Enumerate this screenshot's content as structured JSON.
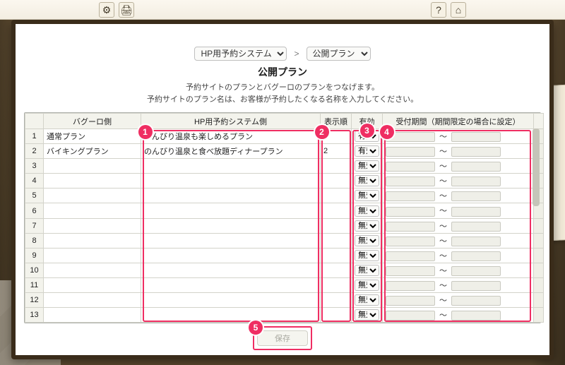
{
  "toolbar": {
    "gear_icon": "⚙",
    "print_icon": "🖨",
    "help_icon": "?",
    "home_icon": "⌂"
  },
  "breadcrumb": {
    "system_select_label": "HP用予約システム",
    "separator": ">",
    "page_select_label": "公開プラン"
  },
  "header": {
    "title": "公開プラン",
    "subtitle_line1": "予約サイトのプランとバグーロのプランをつなげます。",
    "subtitle_line2": "予約サイトのプラン名は、お客様が予約したくなる名称を入力してください。"
  },
  "columns": {
    "bagooro": "バグーロ側",
    "hp_system": "HP用予約システム側",
    "display_order": "表示順",
    "enabled": "有効",
    "period": "受付期間（期間限定の場合に設定）"
  },
  "enabled_options": {
    "on": "有効",
    "off": "無効"
  },
  "period_sep": "〜",
  "rows": [
    {
      "num": 1,
      "bagooro": "通常プラン",
      "hp": "のんびり温泉も楽しめるプラン",
      "order": "1",
      "enabled": "on"
    },
    {
      "num": 2,
      "bagooro": "バイキングプラン",
      "hp": "のんびり温泉と食べ放題ディナープラン",
      "order": "2",
      "enabled": "on"
    },
    {
      "num": 3,
      "bagooro": "",
      "hp": "",
      "order": "",
      "enabled": "off"
    },
    {
      "num": 4,
      "bagooro": "",
      "hp": "",
      "order": "",
      "enabled": "off"
    },
    {
      "num": 5,
      "bagooro": "",
      "hp": "",
      "order": "",
      "enabled": "off"
    },
    {
      "num": 6,
      "bagooro": "",
      "hp": "",
      "order": "",
      "enabled": "off"
    },
    {
      "num": 7,
      "bagooro": "",
      "hp": "",
      "order": "",
      "enabled": "off"
    },
    {
      "num": 8,
      "bagooro": "",
      "hp": "",
      "order": "",
      "enabled": "off"
    },
    {
      "num": 9,
      "bagooro": "",
      "hp": "",
      "order": "",
      "enabled": "off"
    },
    {
      "num": 10,
      "bagooro": "",
      "hp": "",
      "order": "",
      "enabled": "off"
    },
    {
      "num": 11,
      "bagooro": "",
      "hp": "",
      "order": "",
      "enabled": "off"
    },
    {
      "num": 12,
      "bagooro": "",
      "hp": "",
      "order": "",
      "enabled": "off"
    },
    {
      "num": 13,
      "bagooro": "",
      "hp": "",
      "order": "",
      "enabled": "off"
    }
  ],
  "footer": {
    "save_label": "保存"
  },
  "callouts": {
    "1": "1",
    "2": "2",
    "3": "3",
    "4": "4",
    "5": "5"
  },
  "colors": {
    "accent_pink": "#ef2e62"
  }
}
